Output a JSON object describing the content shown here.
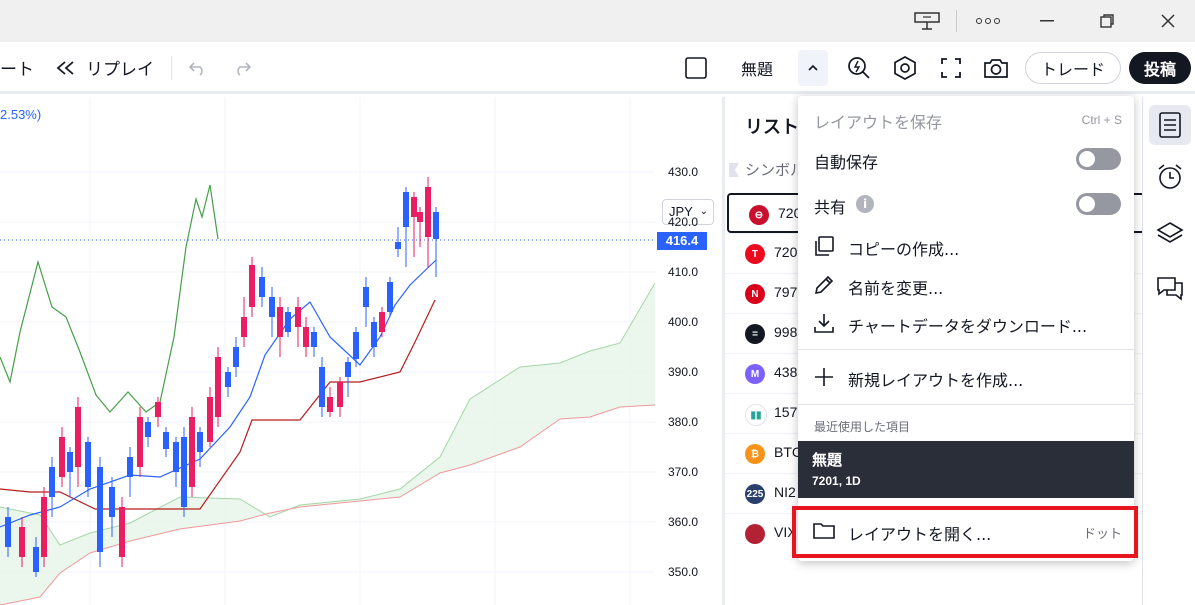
{
  "toolbar": {
    "chart_fragment": "ート",
    "replay_label": "リプレイ",
    "layout_name": "無題",
    "trade_label": "トレード",
    "post_label": "投稿"
  },
  "chart": {
    "change_text": "2.53%)",
    "currency": "JPY",
    "current_price": "416.4",
    "price_ticks": [
      "430.0",
      "420.0",
      "410.0",
      "400.0",
      "390.0",
      "380.0",
      "370.0",
      "360.0",
      "350.0"
    ]
  },
  "watchlist": {
    "title": "リスト",
    "symbol_header": "シンボル",
    "rows": [
      {
        "symbol": "720",
        "logo_color": "#c8102e",
        "logo_text": "⊖"
      },
      {
        "symbol": "720",
        "logo_color": "#eb0a1e",
        "logo_text": "T"
      },
      {
        "symbol": "797",
        "logo_color": "#d9001b",
        "logo_text": "N"
      },
      {
        "symbol": "998",
        "logo_color": "#131722",
        "logo_text": "="
      },
      {
        "symbol": "438",
        "logo_color": "#7b61ff",
        "logo_text": "M"
      },
      {
        "symbol": "157",
        "logo_color": "#ffffff",
        "logo_text": "▮▮"
      },
      {
        "symbol": "BTC",
        "logo_color": "#f7931a",
        "logo_text": "₿"
      },
      {
        "symbol": "NI2",
        "logo_color": "#2a3f6b",
        "logo_text": "225"
      },
      {
        "symbol": "VIX",
        "logo_color": "#b22234",
        "logo_text": ""
      }
    ]
  },
  "menu": {
    "save_layout": "レイアウトを保存",
    "save_shortcut": "Ctrl + S",
    "autosave": "自動保存",
    "share": "共有",
    "make_copy": "コピーの作成...",
    "rename": "名前を変更...",
    "download_data": "チャートデータをダウンロード...",
    "new_layout": "新規レイアウトを作成...",
    "recent_header": "最近使用した項目",
    "recent_title": "無題",
    "recent_sub": "7201, 1D",
    "open_layout": "レイアウトを開く...",
    "open_shortcut": "ドット"
  },
  "colors": {
    "accent": "#2962ff",
    "up_candle": "#2962ff",
    "down_candle": "#e91e63",
    "highlight_box": "#e8141e"
  }
}
